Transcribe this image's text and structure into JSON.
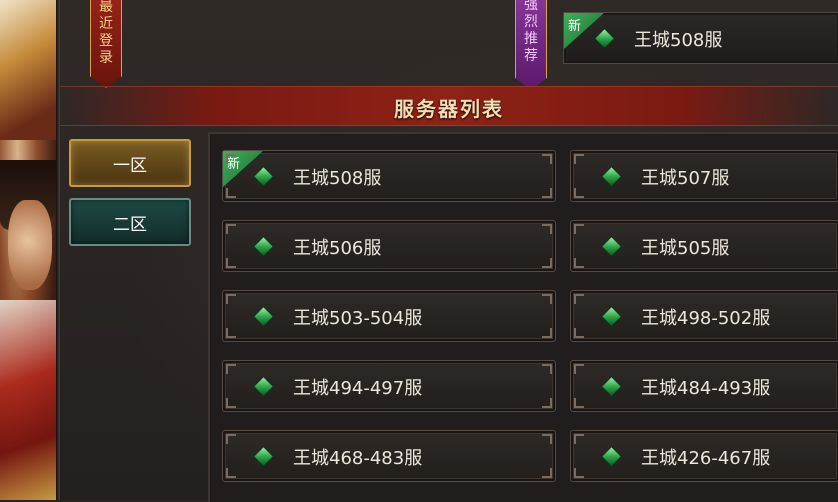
{
  "banners": {
    "recent": [
      "最",
      "近",
      "登",
      "录"
    ],
    "recommend": [
      "强",
      "烈",
      "推",
      "荐"
    ]
  },
  "recommended_server": {
    "name": "王城508服",
    "badge": "新"
  },
  "title": "服务器列表",
  "tabs": [
    {
      "label": "一区",
      "state": "active"
    },
    {
      "label": "二区",
      "state": "inactive"
    }
  ],
  "servers": [
    {
      "name": "王城508服",
      "badge": "新"
    },
    {
      "name": "王城507服",
      "badge": ""
    },
    {
      "name": "王城506服",
      "badge": ""
    },
    {
      "name": "王城505服",
      "badge": ""
    },
    {
      "name": "王城503-504服",
      "badge": ""
    },
    {
      "name": "王城498-502服",
      "badge": ""
    },
    {
      "name": "王城494-497服",
      "badge": ""
    },
    {
      "name": "王城484-493服",
      "badge": ""
    },
    {
      "name": "王城468-483服",
      "badge": ""
    },
    {
      "name": "王城426-467服",
      "badge": ""
    }
  ],
  "colors": {
    "title_bar": "#8e2216",
    "tab_active": "#c99a3a",
    "tab_inactive": "#1f4a44",
    "gem": "#2fa84a",
    "new_tag": "#3fb05a"
  }
}
